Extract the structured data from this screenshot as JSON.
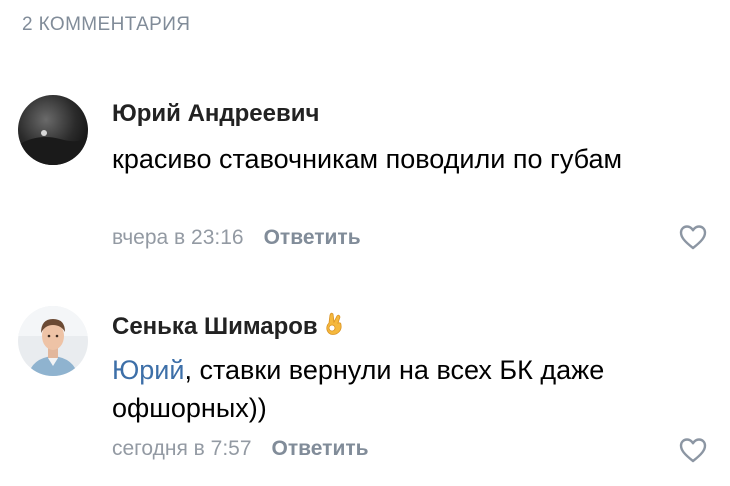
{
  "header": {
    "count_label": "2 КОММЕНТАРИЯ"
  },
  "comments": [
    {
      "author": "Юрий Андреевич",
      "text": "красиво ставочникам поводили по губам",
      "time": "вчера в 23:16",
      "reply_label": "Ответить",
      "avatar_icon": "dark-photo-avatar",
      "like_icon": "heart-outline-icon"
    },
    {
      "author": "Сенька Шимаров",
      "author_emoji": "👌",
      "mention": "Юрий",
      "text": ", ставки вернули на всех БК даже офшорных))",
      "time": "сегодня в 7:57",
      "reply_label": "Ответить",
      "avatar_icon": "person-photo-avatar",
      "like_icon": "heart-outline-icon"
    }
  ],
  "colors": {
    "secondary_text": "#818c99",
    "mention_link": "#3d6fa8",
    "accent_emoji": "#f5b83d"
  }
}
